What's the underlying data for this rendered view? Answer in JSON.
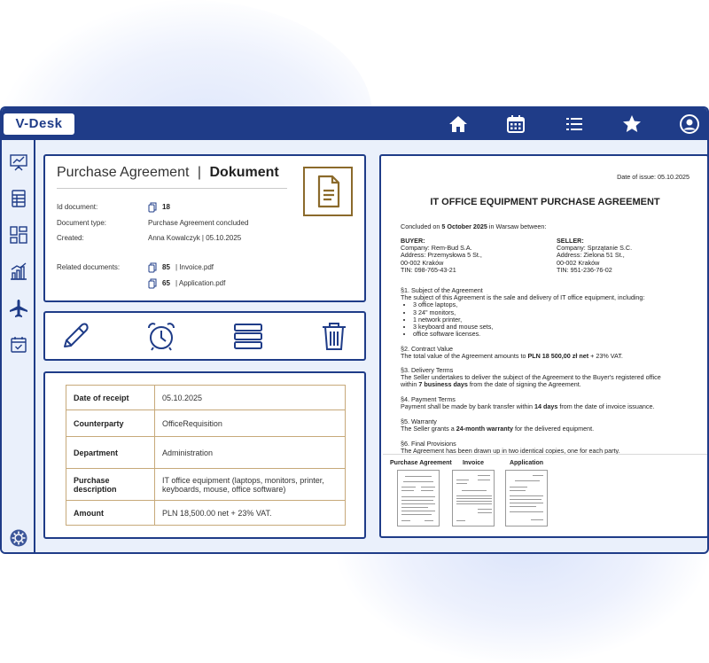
{
  "app": {
    "logo": "V-Desk"
  },
  "topbar_icons": [
    "home-icon",
    "calendar-icon",
    "list-icon",
    "star-icon",
    "user-icon"
  ],
  "sidebar_icons": [
    "presentation-icon",
    "spreadsheet-icon",
    "dashboard-icon",
    "bar-chart-icon",
    "airplane-icon",
    "calendar-check-icon",
    "settings-icon"
  ],
  "doc": {
    "title": "Purchase Agreement",
    "separator": "|",
    "title_bold": "Dokument",
    "id_label": "Id document:",
    "id_value": "18",
    "type_label": "Document type:",
    "type_value": "Purchase Agreement concluded",
    "created_label": "Created:",
    "created_value": "Anna Kowalczyk  |  05.10.2025",
    "related_label": "Related documents:",
    "related": [
      {
        "id": "85",
        "name": "|  Invoice.pdf"
      },
      {
        "id": "65",
        "name": "|  Application.pdf"
      }
    ]
  },
  "actions": [
    "edit-icon",
    "alarm-clock-icon",
    "stack-icon",
    "trash-icon"
  ],
  "info_table": [
    {
      "key": "Date of receipt",
      "value": "05.10.2025"
    },
    {
      "key": "Counterparty",
      "value": "OfficeRequisition"
    },
    {
      "key": "Department",
      "value": "Administration"
    },
    {
      "key": "Purchase description",
      "value": "IT office equipment (laptops, monitors, printer, keyboards, mouse, office software)"
    },
    {
      "key": "Amount",
      "value": "PLN 18,500.00 net + 23% VAT."
    }
  ],
  "letter": {
    "date": "Date of issue: 05.10.2025",
    "heading": "IT OFFICE EQUIPMENT PURCHASE AGREEMENT",
    "concluded_pre": "Concluded on ",
    "concluded_bold": "5 October 2025",
    "concluded_post": " in Warsaw between:",
    "buyer": {
      "label": "BUYER:",
      "company": "Company: Rem-Bud S.A.",
      "address": "Address: Przemysłowa 5 St.,",
      "city": "00-002 Kraków",
      "tin": "TIN: 098-765-43-21"
    },
    "seller": {
      "label": "SELLER:",
      "company": "Company: Sprzątanie S.C.",
      "address": "Address: Zielona 51 St.,",
      "city": "00-002 Kraków",
      "tin": "TIN: 951-236-76-02"
    },
    "s1_title": "§1. Subject of the Agreement",
    "s1_text": "The subject of this Agreement is the sale and delivery of IT office equipment, including:",
    "s1_items": [
      "3 office laptops,",
      "3 24\" monitors,",
      "1 network printer,",
      "3 keyboard and mouse sets,",
      "office software licenses."
    ],
    "s2_title": "§2. Contract Value",
    "s2_pre": "The total value of the Agreement amounts to ",
    "s2_bold": "PLN 18 500,00 zł net",
    "s2_post": " + 23% VAT.",
    "s3_title": "§3. Delivery Terms",
    "s3_text": "The Seller undertakes to deliver the subject of the Agreement to the Buyer's registered office",
    "s3_pre2": "within ",
    "s3_bold": "7 business days",
    "s3_post2": " from the date of signing the Agreement.",
    "s4_title": "§4. Payment Terms",
    "s4_pre": "Payment shall be made by bank transfer within ",
    "s4_bold": "14 days",
    "s4_post": " from the date of invoice issuance.",
    "s5_title": "§5. Warranty",
    "s5_pre": "The Seller grants a ",
    "s5_bold": "24-month warranty",
    "s5_post": " for the delivered equipment.",
    "s6_title": "§6. Final Provisions",
    "s6_text": "The Agreement has been drawn up in two identical copies, one for each party."
  },
  "thumbnails": [
    "Purchase Agreement",
    "Invoice",
    "Application"
  ],
  "colors": {
    "primary": "#1f3c88",
    "accent": "#8b6a2b",
    "panel_bg": "#eaf0fb"
  }
}
